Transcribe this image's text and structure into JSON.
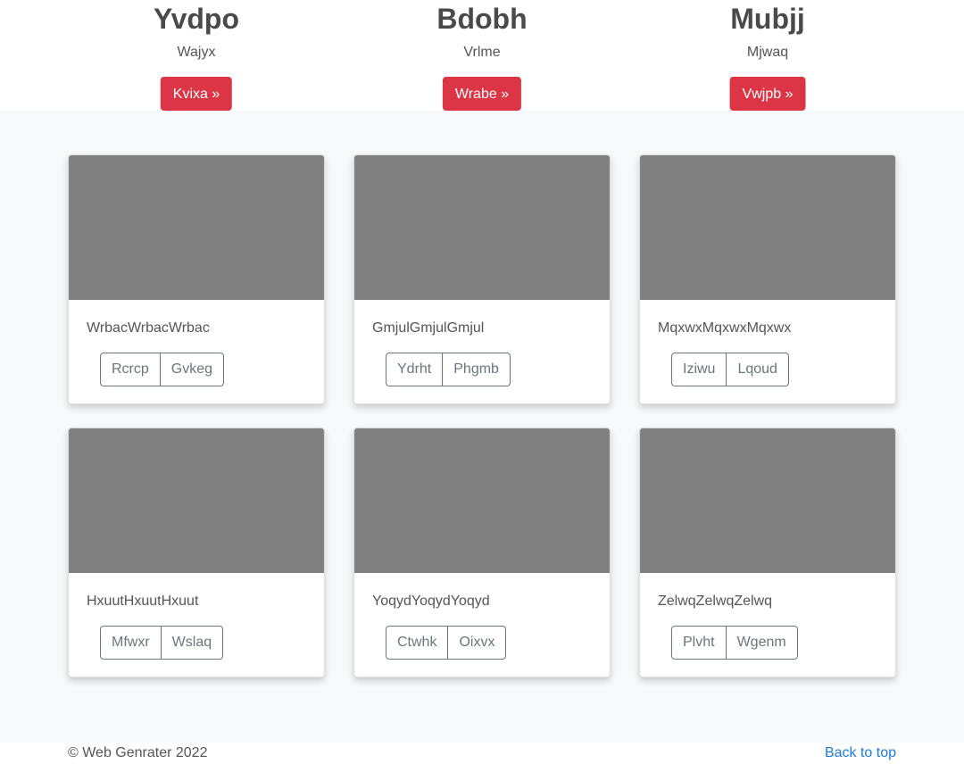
{
  "features": [
    {
      "title": "Yvdpo",
      "subtitle": "Wajyx",
      "button": "Kvixa »"
    },
    {
      "title": "Bdobh",
      "subtitle": "Vrlme",
      "button": "Wrabe »"
    },
    {
      "title": "Mubjj",
      "subtitle": "Mjwaq",
      "button": "Vwjpb »"
    }
  ],
  "cards": [
    {
      "text": "WrbacWrbacWrbac",
      "btn1": "Rcrcp",
      "btn2": "Gvkeg"
    },
    {
      "text": "GmjulGmjulGmjul",
      "btn1": "Ydrht",
      "btn2": "Phgmb"
    },
    {
      "text": "MqxwxMqxwxMqxwx",
      "btn1": "Iziwu",
      "btn2": "Lqoud"
    },
    {
      "text": "HxuutHxuutHxuut",
      "btn1": "Mfwxr",
      "btn2": "Wslaq"
    },
    {
      "text": "YoqydYoqydYoqyd",
      "btn1": "Ctwhk",
      "btn2": "Oixvx"
    },
    {
      "text": "ZelwqZelwqZelwq",
      "btn1": "Plvht",
      "btn2": "Wgenm"
    }
  ],
  "footer": {
    "copyright": "© Web Genrater 2022",
    "back_to_top": "Back to top"
  },
  "colors": {
    "accent_red": "#dc3545",
    "placeholder_gray": "#808080",
    "link_blue": "#1e7be0",
    "album_bg": "#f8f9fa"
  }
}
